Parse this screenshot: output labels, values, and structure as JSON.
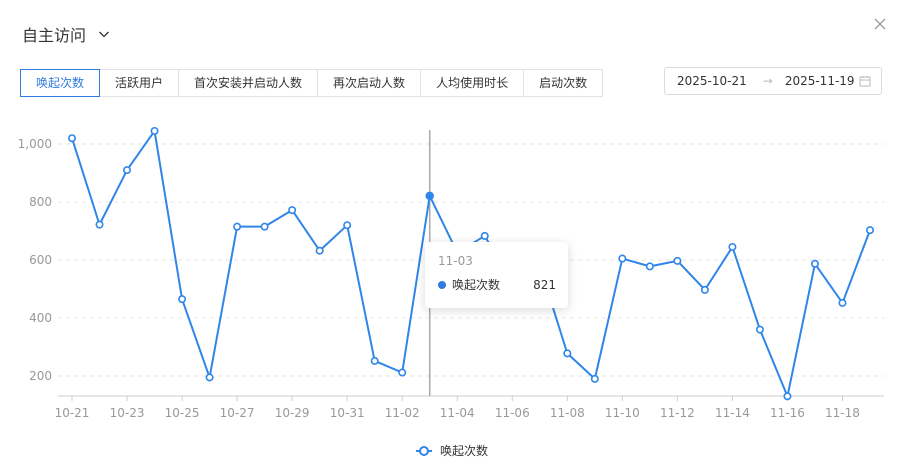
{
  "header": {
    "title": "自主访问"
  },
  "tabs": [
    {
      "label": "唤起次数",
      "active": true
    },
    {
      "label": "活跃用户",
      "active": false
    },
    {
      "label": "首次安装并启动人数",
      "active": false
    },
    {
      "label": "再次启动人数",
      "active": false
    },
    {
      "label": "人均使用时长",
      "active": false
    },
    {
      "label": "启动次数",
      "active": false
    }
  ],
  "date_range": {
    "start": "2025-10-21",
    "end": "2025-11-19",
    "separator": "→"
  },
  "tooltip": {
    "date": "11-03",
    "series": "唤起次数",
    "value": "821"
  },
  "legend": {
    "label": "唤起次数"
  },
  "colors": {
    "accent": "#2f7be0",
    "line": "#2f86e8",
    "grid": "#e6e6e6",
    "axis_text": "#999999"
  },
  "chart_data": {
    "type": "line",
    "x": [
      "10-21",
      "10-22",
      "10-23",
      "10-24",
      "10-25",
      "10-26",
      "10-27",
      "10-28",
      "10-29",
      "10-30",
      "10-31",
      "11-01",
      "11-02",
      "11-03",
      "11-04",
      "11-05",
      "11-06",
      "11-07",
      "11-08",
      "11-09",
      "11-10",
      "11-11",
      "11-12",
      "11-13",
      "11-14",
      "11-15",
      "11-16",
      "11-17",
      "11-18",
      "11-19"
    ],
    "x_tick_labels": [
      "10-21",
      "10-23",
      "10-25",
      "10-27",
      "10-29",
      "10-31",
      "11-02",
      "11-04",
      "11-06",
      "11-08",
      "11-10",
      "11-12",
      "11-14",
      "11-16",
      "11-18"
    ],
    "series": [
      {
        "name": "唤起次数",
        "values": [
          1020,
          722,
          910,
          1045,
          465,
          195,
          715,
          715,
          772,
          632,
          720,
          252,
          212,
          821,
          626,
          683,
          520,
          580,
          278,
          190,
          605,
          578,
          597,
          497,
          645,
          360,
          130,
          587,
          452,
          703
        ]
      }
    ],
    "y_ticks": [
      200,
      400,
      600,
      800,
      1000
    ],
    "y_tick_labels": [
      "200",
      "400",
      "600",
      "800",
      "1,000"
    ],
    "ylim": [
      140,
      1080
    ],
    "highlight_index": 13,
    "grid": true,
    "legend": "bottom-center",
    "xlabel": "",
    "ylabel": ""
  }
}
